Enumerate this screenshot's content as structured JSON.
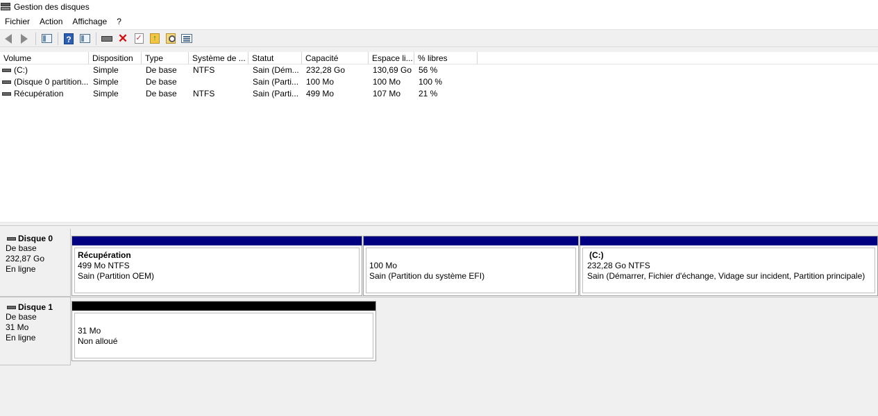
{
  "window": {
    "title": "Gestion des disques"
  },
  "menu": [
    "Fichier",
    "Action",
    "Affichage",
    "?"
  ],
  "toolbar": {
    "icons": [
      "back-arrow-icon",
      "forward-arrow-icon",
      "console-tree-icon",
      "help-icon",
      "properties-icon",
      "disk-icon",
      "delete-icon",
      "check-icon",
      "folder-up-icon",
      "search-icon",
      "list-icon"
    ]
  },
  "volume_list": {
    "columns": [
      "Volume",
      "Disposition",
      "Type",
      "Système de ...",
      "Statut",
      "Capacité",
      "Espace li...",
      "% libres"
    ],
    "rows": [
      [
        "(C:)",
        "Simple",
        "De base",
        "NTFS",
        "Sain (Dém...",
        "232,28 Go",
        "130,69 Go",
        "56 %"
      ],
      [
        "(Disque 0 partition...",
        "Simple",
        "De base",
        "",
        "Sain (Parti...",
        "100 Mo",
        "100 Mo",
        "100 %"
      ],
      [
        "Récupération",
        "Simple",
        "De base",
        "NTFS",
        "Sain (Parti...",
        "499 Mo",
        "107 Mo",
        "21 %"
      ]
    ]
  },
  "disks": [
    {
      "name": "Disque 0",
      "type": "De base",
      "size": "232,87 Go",
      "state": "En ligne",
      "partitions": [
        {
          "name": "Récupération",
          "size": "499 Mo NTFS",
          "status": "Sain (Partition OEM)",
          "bar_color": "#000080"
        },
        {
          "name": "",
          "size": "100 Mo",
          "status": "Sain (Partition du système EFI)",
          "bar_color": "#000080"
        },
        {
          "name": "(C:)",
          "size": "232,28 Go NTFS",
          "status": "Sain (Démarrer, Fichier d'échange, Vidage sur incident, Partition principale)",
          "bar_color": "#000080"
        }
      ]
    },
    {
      "name": "Disque 1",
      "type": "De base",
      "size": "31 Mo",
      "state": "En ligne",
      "partitions": [
        {
          "name": "",
          "size": "31 Mo",
          "status": "Non alloué",
          "bar_color": "#000000"
        }
      ]
    }
  ]
}
